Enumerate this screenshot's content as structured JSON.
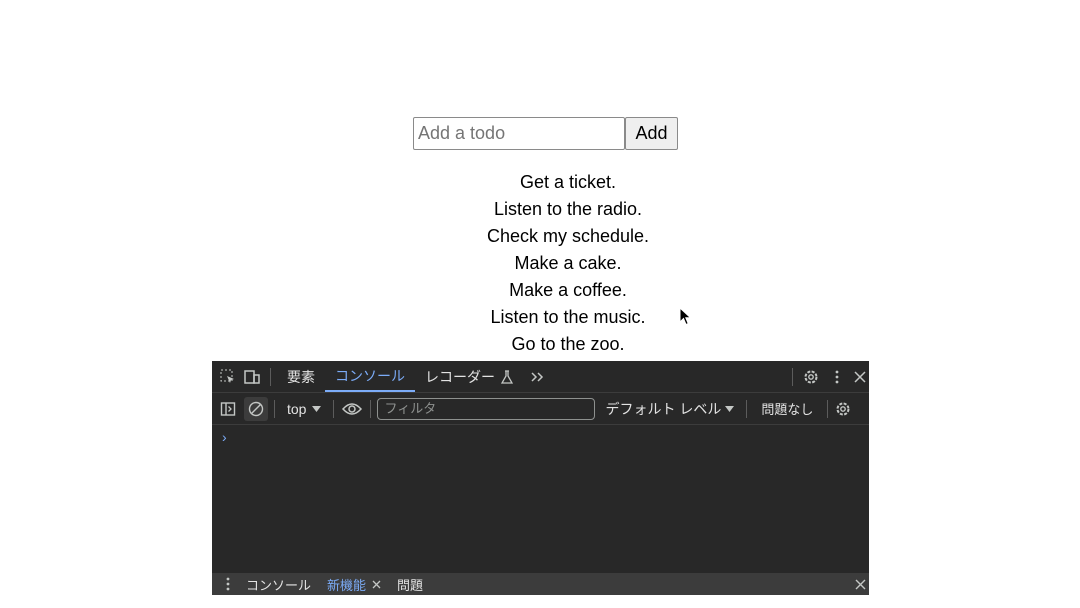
{
  "app": {
    "input": {
      "placeholder": "Add a todo",
      "value": ""
    },
    "add_label": "Add",
    "todos": [
      "Get a ticket.",
      "Listen to the radio.",
      "Check my schedule.",
      "Make a cake.",
      "Make a coffee.",
      "Listen to the music.",
      "Go to the zoo."
    ]
  },
  "devtools": {
    "tabs": [
      "要素",
      "コンソール",
      "レコーダー"
    ],
    "active_tab": "コンソール",
    "more_tabs_icon": "chevron-double-right-icon",
    "context": "top",
    "filter_placeholder": "フィルタ",
    "level": "デフォルト レベル",
    "issues": "問題なし",
    "prompt": "›",
    "drawer_tabs": [
      "コンソール",
      "新機能",
      "問題"
    ],
    "drawer_active": "新機能",
    "accent_color": "#7cacf8",
    "background_color": "#282828"
  }
}
